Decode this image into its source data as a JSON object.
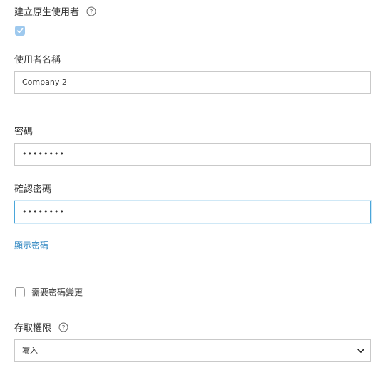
{
  "native_user": {
    "label": "建立原生使用者",
    "checked": true
  },
  "username": {
    "label": "使用者名稱",
    "value": "Company 2"
  },
  "password": {
    "label": "密碼",
    "masked_value": "••••••••"
  },
  "confirm_password": {
    "label": "確認密碼",
    "masked_value": "••••••••"
  },
  "show_password_link": "顯示密碼",
  "require_change": {
    "label": "需要密碼變更",
    "checked": false
  },
  "access": {
    "label": "存取權限",
    "selected": "寫入"
  },
  "colors": {
    "accent": "#2e86c1",
    "focus_border": "#4aa6da",
    "checkbox_checked": "#9ec9ee"
  },
  "icons": {
    "help": "help-circle-icon",
    "check": "check-icon",
    "dropdown": "chevron-down-icon"
  }
}
